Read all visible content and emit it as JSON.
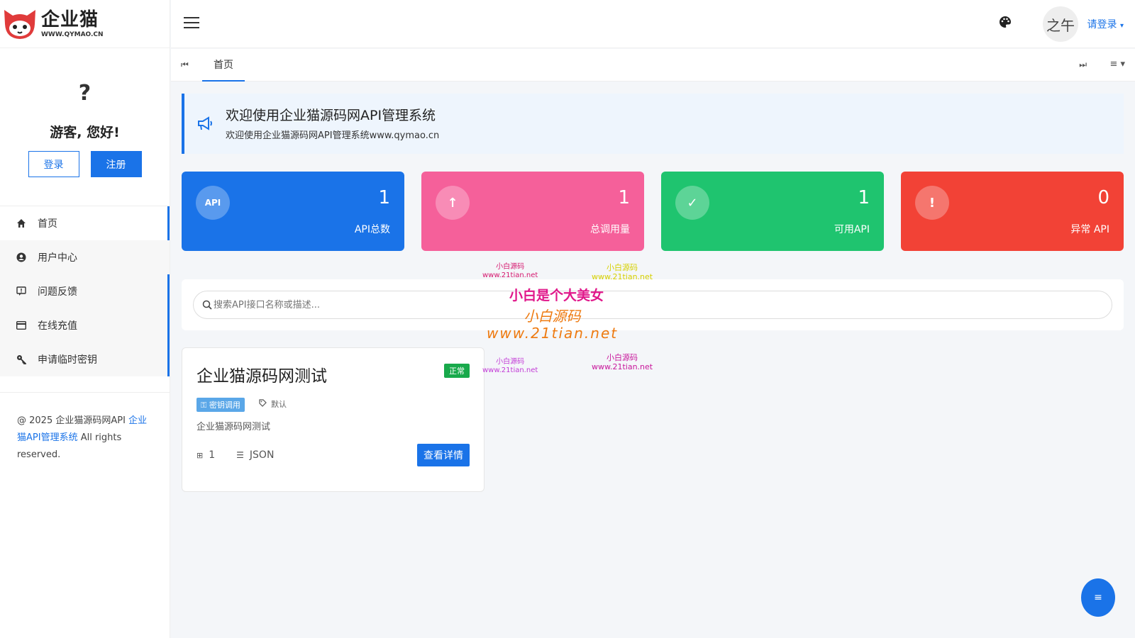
{
  "logo": {
    "name": "企业猫",
    "url": "WWW.QYMAO.CN"
  },
  "user": {
    "avatar_char": "?",
    "greeting": "游客, 您好!",
    "login_label": "登录",
    "register_label": "注册"
  },
  "nav": [
    {
      "label": "首页",
      "icon": "home-icon"
    },
    {
      "label": "用户中心",
      "icon": "user-icon"
    },
    {
      "label": "问题反馈",
      "icon": "feedback-icon"
    },
    {
      "label": "在线充值",
      "icon": "card-icon"
    },
    {
      "label": "申请临时密钥",
      "icon": "key-icon"
    }
  ],
  "footer": {
    "prefix": "@ 2025 企业猫源码网API ",
    "link": "企业猫API管理系统",
    "suffix": " All rights reserved."
  },
  "header": {
    "avatar_text": "之午",
    "login_link": "请登录"
  },
  "tabs": [
    {
      "label": "首页"
    }
  ],
  "notice": {
    "title": "欢迎使用企业猫源码网API管理系统",
    "subtitle": "欢迎使用企业猫源码网API管理系统www.qymao.cn"
  },
  "stats": [
    {
      "icon_text": "API",
      "value": "1",
      "label": "API总数",
      "color": "#1a73e8"
    },
    {
      "icon_text": "↑",
      "value": "1",
      "label": "总调用量",
      "color": "#f5609a"
    },
    {
      "icon_text": "✓",
      "value": "1",
      "label": "可用API",
      "color": "#1fc46f"
    },
    {
      "icon_text": "!",
      "value": "0",
      "label": "异常 API",
      "color": "#f24236"
    }
  ],
  "search": {
    "placeholder": "搜索API接口名称或描述..."
  },
  "api_card": {
    "title": "企业猫源码网测试",
    "status": "正常",
    "tag": "密钥调用",
    "category": "默认",
    "description": "企业猫源码网测试",
    "calls": "1",
    "format": "JSON",
    "detail_label": "查看详情"
  },
  "fab": {
    "icon": "≡"
  },
  "watermarks": {
    "small1": "小白源码",
    "small1_url": "www.21tian.net",
    "small2": "小白源码",
    "small2_url": "www.21tian.net",
    "big": "小白是个大美女",
    "mid": "小白源码",
    "mid_url": "www.21tian.net",
    "small3": "小白源码",
    "small3_url": "www.21tian.net",
    "small4": "小白源码",
    "small4_url": "www.21tian.net"
  }
}
